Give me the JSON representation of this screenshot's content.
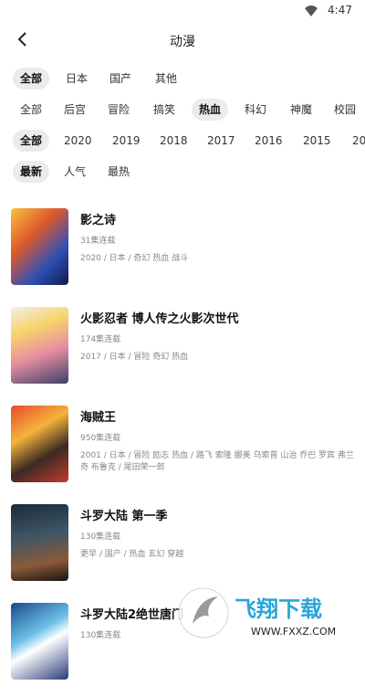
{
  "status": {
    "time": "4:47"
  },
  "header": {
    "title": "动漫"
  },
  "filters": {
    "region": [
      "全部",
      "日本",
      "国产",
      "其他"
    ],
    "genre": [
      "全部",
      "后宫",
      "冒险",
      "搞笑",
      "热血",
      "科幻",
      "神魔",
      "校园"
    ],
    "year": [
      "全部",
      "2020",
      "2019",
      "2018",
      "2017",
      "2016",
      "2015",
      "20"
    ],
    "sort": [
      "最新",
      "人气",
      "最热"
    ]
  },
  "items": [
    {
      "name": "影之诗",
      "eps": "31集连载",
      "meta": "2020 / 日本 / 奇幻 热血 战斗"
    },
    {
      "name": "火影忍者 博人传之火影次世代",
      "eps": "174集连载",
      "meta": "2017 / 日本 / 冒险 奇幻 热血"
    },
    {
      "name": "海贼王",
      "eps": "950集连载",
      "meta": "2001 / 日本 / 冒险 励志 热血 / 路飞 索隆 娜美 乌索普 山治 乔巴 罗宾 弗兰奇 布鲁克 / 尾田荣一郎"
    },
    {
      "name": "斗罗大陆 第一季",
      "eps": "130集连载",
      "meta": "更早 / 国产 / 热血 玄幻 穿越"
    },
    {
      "name": "斗罗大陆2绝世唐门",
      "eps": "130集连载",
      "meta": ""
    }
  ],
  "watermark": {
    "brand": "飞翔下载",
    "url": "WWW.FXXZ.COM"
  }
}
